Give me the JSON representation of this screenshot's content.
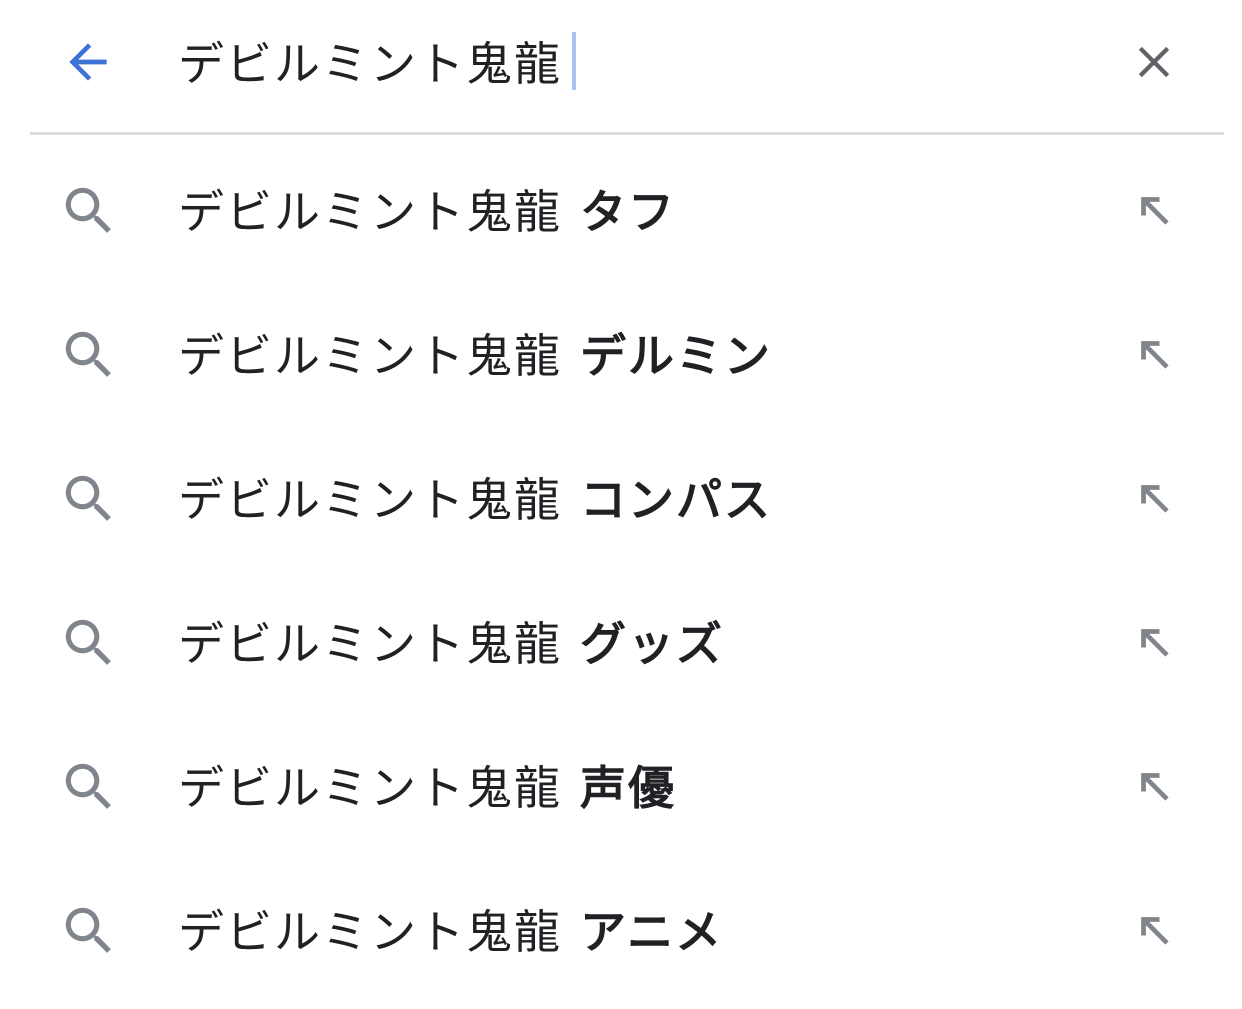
{
  "search": {
    "query": "デビルミント鬼龍",
    "back_icon": "arrow-left-icon",
    "clear_icon": "close-icon",
    "accent_color": "#3d72d6"
  },
  "suggestions": [
    {
      "prefix": "デビルミント鬼龍",
      "completion": "タフ"
    },
    {
      "prefix": "デビルミント鬼龍",
      "completion": "デルミン"
    },
    {
      "prefix": "デビルミント鬼龍",
      "completion": "コンパス"
    },
    {
      "prefix": "デビルミント鬼龍",
      "completion": "グッズ"
    },
    {
      "prefix": "デビルミント鬼龍",
      "completion": "声優"
    },
    {
      "prefix": "デビルミント鬼龍",
      "completion": "アニメ"
    }
  ],
  "icons": {
    "suggestion_icon": "search-icon",
    "fill_icon": "arrow-up-left-icon",
    "icon_color": "#80868b"
  }
}
